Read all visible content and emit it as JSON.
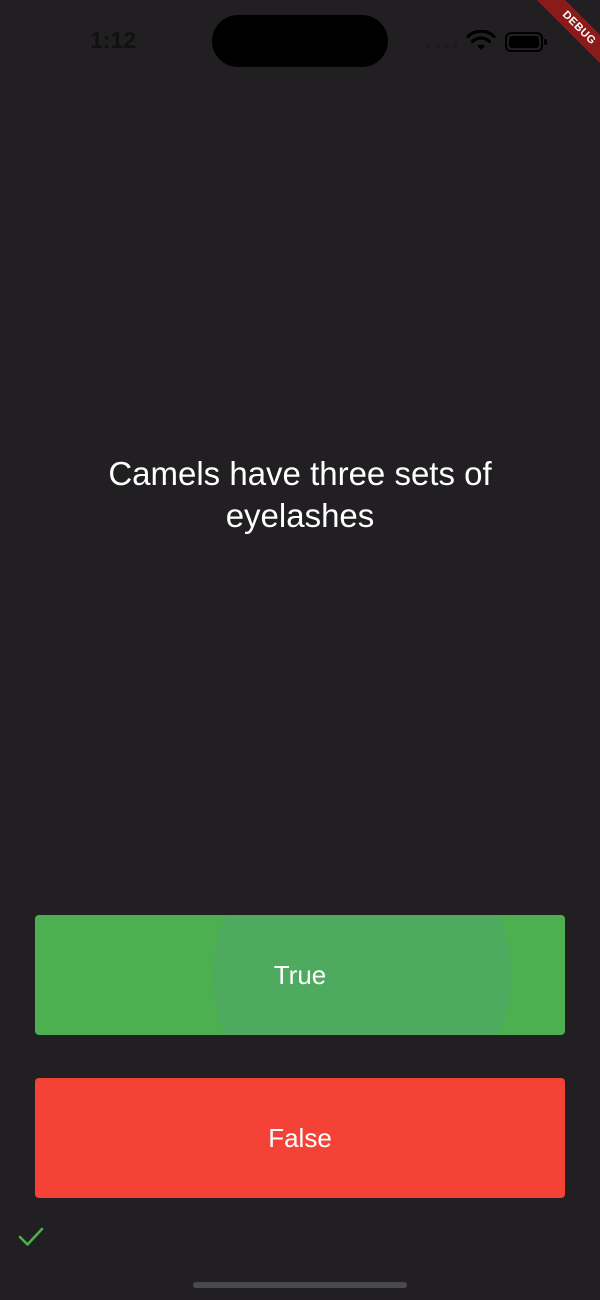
{
  "status_bar": {
    "time": "1:12"
  },
  "debug_banner": {
    "label": "DEBUG"
  },
  "quiz": {
    "question": "Camels have three sets of eyelashes",
    "true_label": "True",
    "false_label": "False"
  },
  "score": {
    "icons": [
      "check-icon"
    ]
  },
  "colors": {
    "background": "#211f22",
    "true_button": "#4caf50",
    "false_button": "#f44336",
    "check": "#4caf50",
    "debug_ribbon": "#8b1a1a"
  }
}
